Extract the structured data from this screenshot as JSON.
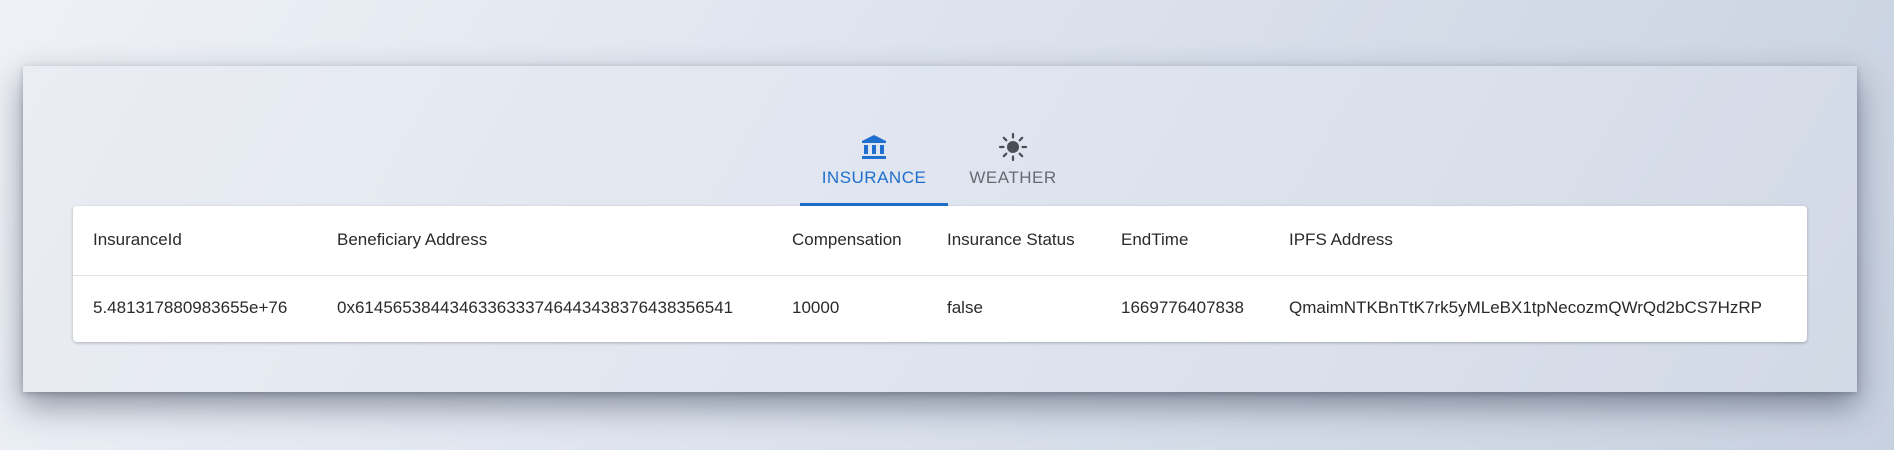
{
  "tabs": [
    {
      "label": "INSURANCE",
      "icon": "bank-icon",
      "active": true
    },
    {
      "label": "WEATHER",
      "icon": "sun-icon",
      "active": false
    }
  ],
  "colors": {
    "accent": "#1f6fcf",
    "inactive_tab": "#666b73"
  },
  "table": {
    "headers": [
      "InsuranceId",
      "Beneficiary Address",
      "Compensation",
      "Insurance Status",
      "EndTime",
      "IPFS Address"
    ],
    "rows": [
      [
        "5.481317880983655e+76",
        "0x6145653844346336333746443438376438356541",
        "10000",
        "false",
        "1669776407838",
        "QmaimNTKBnTtK7rk5yMLeBX1tpNecozmQWrQd2bCS7HzRP"
      ]
    ]
  }
}
